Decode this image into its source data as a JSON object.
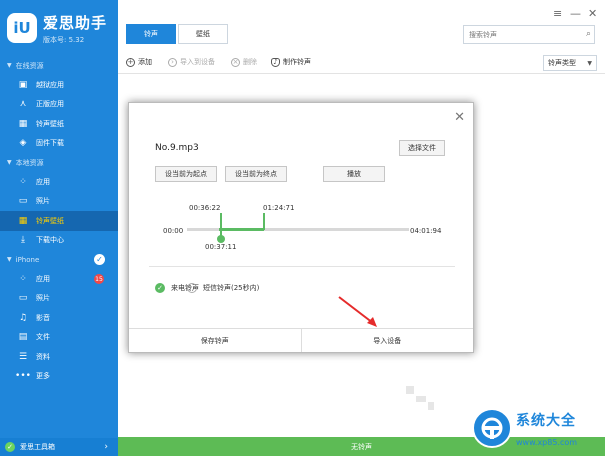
{
  "sidebar": {
    "brand": {
      "logo": "iU",
      "name": "爱思助手",
      "version": "版本号: 5.32"
    },
    "sections": [
      {
        "title": "在线资源",
        "items": [
          {
            "label": "越狱应用",
            "icon": "box-icon"
          },
          {
            "label": "正版应用",
            "icon": "app-store-icon"
          },
          {
            "label": "铃声壁纸",
            "icon": "film-icon"
          },
          {
            "label": "固件下载",
            "icon": "cube-icon"
          }
        ]
      },
      {
        "title": "本地资源",
        "items": [
          {
            "label": "应用",
            "icon": "grid-icon"
          },
          {
            "label": "照片",
            "icon": "photo-icon"
          },
          {
            "label": "铃声壁纸",
            "icon": "film-icon",
            "active": true
          },
          {
            "label": "下载中心",
            "icon": "download-icon"
          }
        ]
      },
      {
        "title": "iPhone",
        "items": [
          {
            "label": "应用",
            "icon": "grid-icon",
            "badge": "15"
          },
          {
            "label": "照片",
            "icon": "photo-icon"
          },
          {
            "label": "影音",
            "icon": "music-icon"
          },
          {
            "label": "文件",
            "icon": "folder-icon"
          },
          {
            "label": "资料",
            "icon": "list-icon"
          },
          {
            "label": "更多",
            "icon": "more-icon"
          }
        ]
      }
    ],
    "footer": {
      "label": "爱思工具箱"
    }
  },
  "header": {
    "tabs": [
      "铃声",
      "壁纸"
    ],
    "search_placeholder": "搜索铃声"
  },
  "toolbar": {
    "add": "添加",
    "import_device": "导入到设备",
    "delete": "删除",
    "make_ringtone": "制作铃声",
    "type_select": "铃声类型"
  },
  "dialog": {
    "file_name": "No.9.mp3",
    "choose_file": "选择文件",
    "set_start": "设当前为起点",
    "set_end": "设当前为终点",
    "play": "播放",
    "time_start": "00:36:22",
    "time_end": "01:24:71",
    "time_zero": "00:00",
    "time_total": "04:01:94",
    "time_current": "00:37:11",
    "radio_call": "来电铃声",
    "radio_sms": "短信铃声(25秒内)",
    "save": "保存铃声",
    "import": "导入设备"
  },
  "statusbar": {
    "text": "无铃声"
  },
  "watermark": {
    "text": "系统大全",
    "sub": "www.xp85.com"
  },
  "colors": {
    "accent": "#1f86da",
    "active_bg": "#1567b0",
    "active_text": "#ffd000",
    "green": "#5bbb63",
    "badge": "#f04848"
  }
}
